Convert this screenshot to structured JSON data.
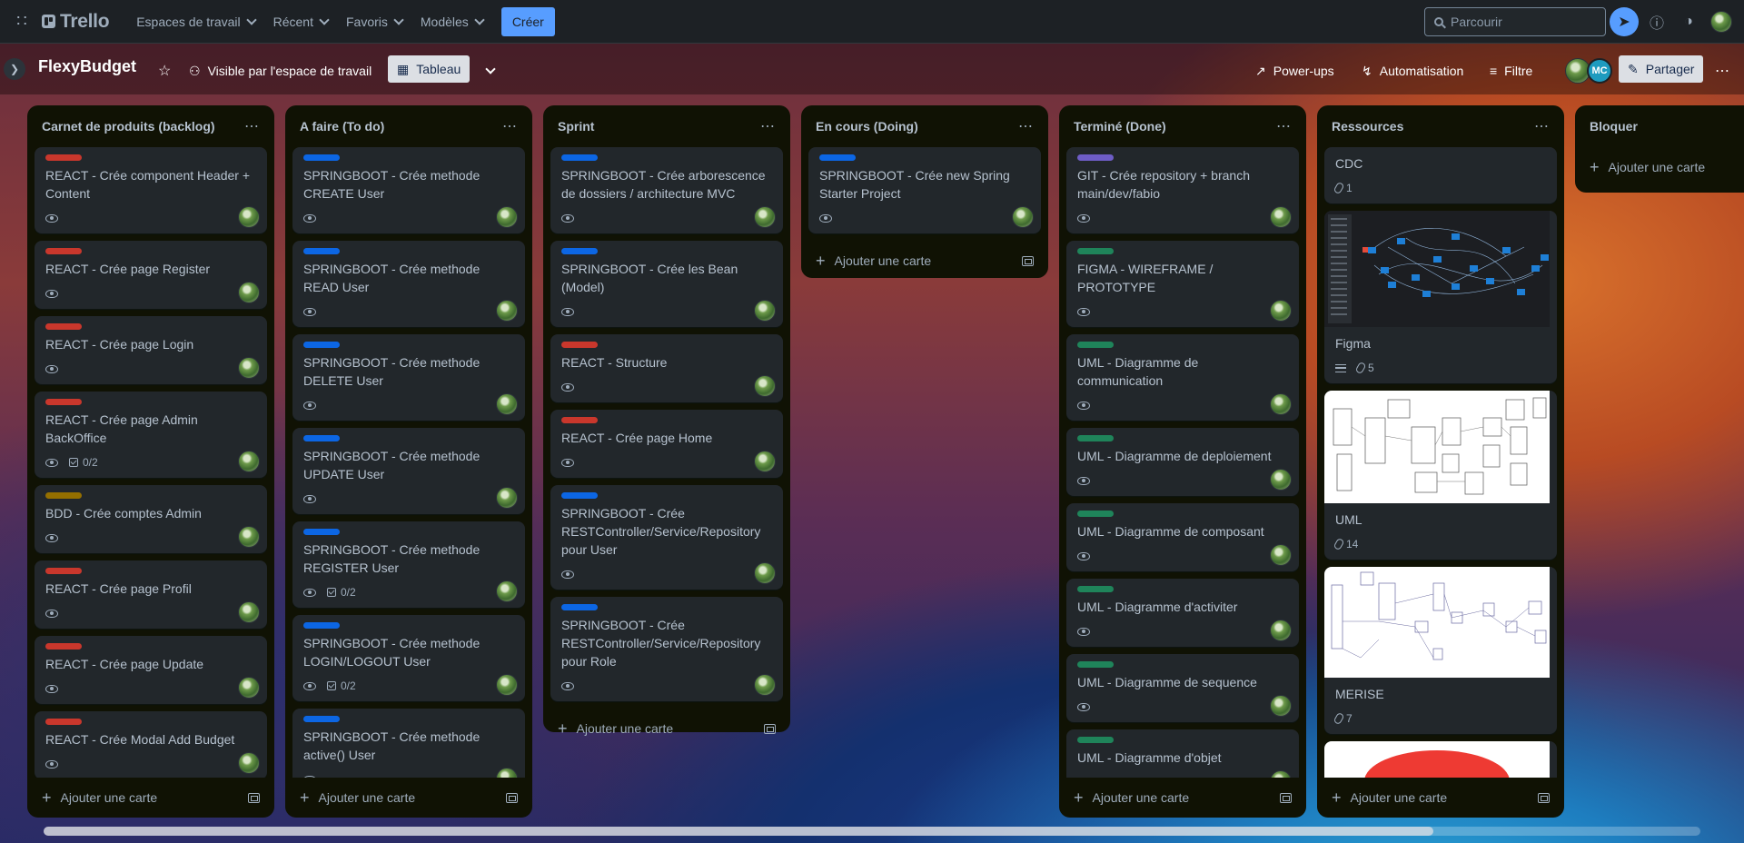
{
  "topnav": {
    "brand": "Trello",
    "menus": [
      "Espaces de travail",
      "Récent",
      "Favoris",
      "Modèles"
    ],
    "create_label": "Créer",
    "search_placeholder": "Parcourir"
  },
  "board": {
    "title": "FlexyBudget",
    "visibility": "Visible par l'espace de travail",
    "view": "Tableau",
    "powerups": "Power-ups",
    "automation": "Automatisation",
    "filter": "Filtre",
    "share": "Partager",
    "member_initials": "MC"
  },
  "add_card_label": "Ajouter une carte",
  "label_colors": {
    "red": "#c9372c",
    "blue": "#0c66e4",
    "yellow": "#946f00",
    "green": "#1f845a",
    "purple": "#6e5dc6"
  },
  "lists": [
    {
      "title": "Carnet de produits (backlog)",
      "cards": [
        {
          "label": "red",
          "title": "REACT - Crée component Header + Content",
          "watch": true
        },
        {
          "label": "red",
          "title": "REACT - Crée page Register",
          "watch": true
        },
        {
          "label": "red",
          "title": "REACT - Crée page Login",
          "watch": true
        },
        {
          "label": "red",
          "title": "REACT - Crée page Admin BackOffice",
          "watch": true,
          "checklist": "0/2"
        },
        {
          "label": "yellow",
          "title": "BDD - Crée comptes Admin",
          "watch": true
        },
        {
          "label": "red",
          "title": "REACT - Crée page Profil",
          "watch": true
        },
        {
          "label": "red",
          "title": "REACT - Crée page Update",
          "watch": true
        },
        {
          "label": "red",
          "title": "REACT - Crée Modal Add Budget",
          "watch": true
        }
      ]
    },
    {
      "title": "A faire (To do)",
      "cards": [
        {
          "label": "blue",
          "title": "SPRINGBOOT - Crée methode CREATE User",
          "watch": true
        },
        {
          "label": "blue",
          "title": "SPRINGBOOT - Crée methode READ User",
          "watch": true
        },
        {
          "label": "blue",
          "title": "SPRINGBOOT - Crée methode DELETE User",
          "watch": true
        },
        {
          "label": "blue",
          "title": "SPRINGBOOT - Crée methode UPDATE User",
          "watch": true
        },
        {
          "label": "blue",
          "title": "SPRINGBOOT - Crée methode REGISTER User",
          "watch": true,
          "checklist": "0/2"
        },
        {
          "label": "blue",
          "title": "SPRINGBOOT - Crée methode LOGIN/LOGOUT User",
          "watch": true,
          "checklist": "0/2"
        },
        {
          "label": "blue",
          "title": "SPRINGBOOT - Crée methode active() User",
          "watch": true
        }
      ]
    },
    {
      "title": "Sprint",
      "cards": [
        {
          "label": "blue",
          "title": "SPRINGBOOT - Crée arborescence de dossiers / architecture MVC",
          "watch": true
        },
        {
          "label": "blue",
          "title": "SPRINGBOOT - Crée les Bean (Model)",
          "watch": true
        },
        {
          "label": "red",
          "title": "REACT - Structure",
          "watch": true
        },
        {
          "label": "red",
          "title": "REACT - Crée page Home",
          "watch": true
        },
        {
          "label": "blue",
          "title": "SPRINGBOOT - Crée RESTController/Service/Repository pour User",
          "watch": true
        },
        {
          "label": "blue",
          "title": "SPRINGBOOT - Crée RESTController/Service/Repository pour Role",
          "watch": true
        }
      ]
    },
    {
      "title": "En cours (Doing)",
      "cards": [
        {
          "label": "blue",
          "title": "SPRINGBOOT - Crée new Spring Starter Project",
          "watch": true
        }
      ]
    },
    {
      "title": "Terminé (Done)",
      "cards": [
        {
          "label": "purple",
          "title": "GIT - Crée repository + branch main/dev/fabio",
          "watch": true
        },
        {
          "label": "green",
          "title": "FIGMA - WIREFRAME / PROTOTYPE",
          "watch": true
        },
        {
          "label": "green",
          "title": "UML - Diagramme de communication",
          "watch": true
        },
        {
          "label": "green",
          "title": "UML - Diagramme de deploiement",
          "watch": true
        },
        {
          "label": "green",
          "title": "UML - Diagramme de composant",
          "watch": true
        },
        {
          "label": "green",
          "title": "UML - Diagramme d'activiter",
          "watch": true
        },
        {
          "label": "green",
          "title": "UML - Diagramme de sequence",
          "watch": true
        },
        {
          "label": "green",
          "title": "UML - Diagramme d'objet",
          "watch": true
        }
      ]
    },
    {
      "title": "Ressources",
      "cards": [
        {
          "title": "CDC",
          "attachments": "1"
        },
        {
          "title": "Figma",
          "cover": "dark-diagram",
          "description": true,
          "attachments": "5"
        },
        {
          "title": "UML",
          "cover": "light-diagram",
          "attachments": "14"
        },
        {
          "title": "MERISE",
          "cover": "light-merise",
          "attachments": "7"
        },
        {
          "title": "",
          "cover": "red-shape"
        }
      ]
    },
    {
      "title": "Bloquer",
      "cards": []
    }
  ]
}
